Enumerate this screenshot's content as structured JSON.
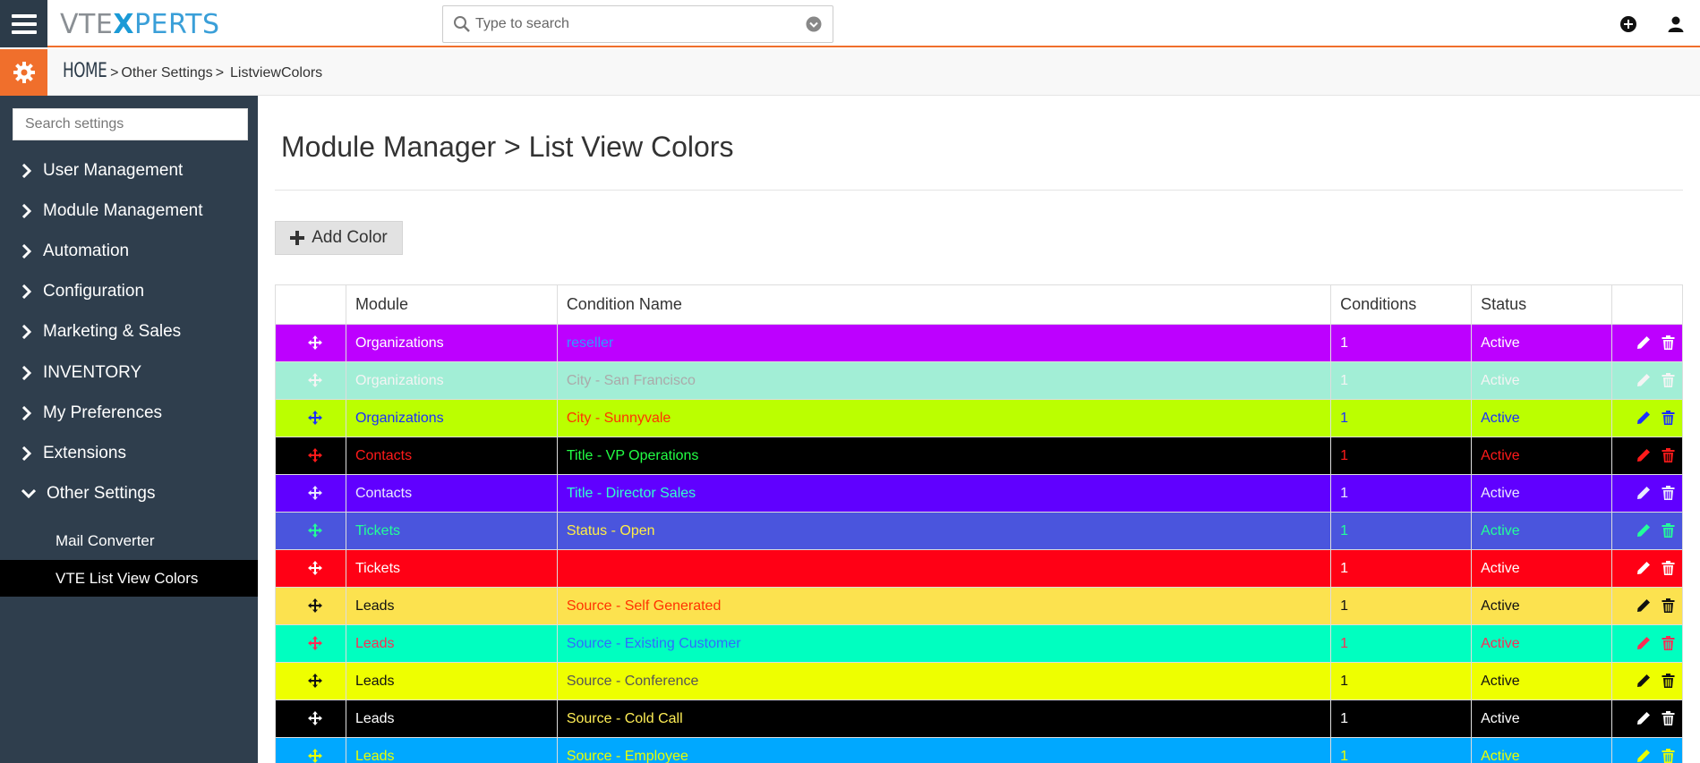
{
  "header": {
    "logo_part1": "VTE",
    "logo_part2": "X",
    "logo_part3": "PERTS",
    "search_placeholder": "Type to search",
    "icons": {
      "menu": "hamburger-icon",
      "search": "search-icon",
      "dropdown": "chevron-circle-down-icon",
      "add": "plus-circle-icon",
      "user": "user-icon"
    }
  },
  "breadcrumb": {
    "home": "HOME",
    "sep": ">",
    "item1": "Other Settings",
    "item2": "ListviewColors",
    "icon": "gear-icon"
  },
  "sidebar": {
    "search_placeholder": "Search settings",
    "items": [
      {
        "label": "User Management",
        "expanded": false
      },
      {
        "label": "Module Management",
        "expanded": false
      },
      {
        "label": "Automation",
        "expanded": false
      },
      {
        "label": "Configuration",
        "expanded": false
      },
      {
        "label": "Marketing & Sales",
        "expanded": false
      },
      {
        "label": "INVENTORY",
        "expanded": false
      },
      {
        "label": "My Preferences",
        "expanded": false
      },
      {
        "label": "Extensions",
        "expanded": false
      },
      {
        "label": "Other Settings",
        "expanded": true
      }
    ],
    "subitems": [
      {
        "label": "Mail Converter",
        "active": false
      },
      {
        "label": "VTE List View Colors",
        "active": true
      }
    ]
  },
  "main": {
    "title": "Module Manager > List View Colors",
    "add_button": "Add Color",
    "columns": [
      "",
      "Module",
      "Condition Name",
      "Conditions",
      "Status",
      ""
    ],
    "rows": [
      {
        "module": "Organizations",
        "condition": "reseller",
        "conditions": "1",
        "status": "Active",
        "bg": "#bd00ff",
        "fg": "#ffffff",
        "cond_fg": "#2f9bff"
      },
      {
        "module": "Organizations",
        "condition": "City - San Francisco",
        "conditions": "1",
        "status": "Active",
        "bg": "#a2eed6",
        "fg": "#f4f4f4",
        "cond_fg": "#aaaaaa"
      },
      {
        "module": "Organizations",
        "condition": "City - Sunnyvale",
        "conditions": "1",
        "status": "Active",
        "bg": "#bbff00",
        "fg": "#1a2fff",
        "cond_fg": "#ff3300"
      },
      {
        "module": "Contacts",
        "condition": "Title - VP Operations",
        "conditions": "1",
        "status": "Active",
        "bg": "#000000",
        "fg": "#ff1a1a",
        "cond_fg": "#22ff44"
      },
      {
        "module": "Contacts",
        "condition": "Title - Director Sales",
        "conditions": "1",
        "status": "Active",
        "bg": "#6000ff",
        "fg": "#eaeaff",
        "cond_fg": "#33ffcc"
      },
      {
        "module": "Tickets",
        "condition": "Status - Open",
        "conditions": "1",
        "status": "Active",
        "bg": "#4a55dd",
        "fg": "#22ff99",
        "cond_fg": "#ffee44"
      },
      {
        "module": "Tickets",
        "condition": "",
        "conditions": "1",
        "status": "Active",
        "bg": "#ff0015",
        "fg": "#ffffff",
        "cond_fg": "#ffffff"
      },
      {
        "module": "Leads",
        "condition": "Source - Self Generated",
        "conditions": "1",
        "status": "Active",
        "bg": "#fce24f",
        "fg": "#111111",
        "cond_fg": "#ff3300"
      },
      {
        "module": "Leads",
        "condition": "Source - Existing Customer",
        "conditions": "1",
        "status": "Active",
        "bg": "#00ffc0",
        "fg": "#ff2a55",
        "cond_fg": "#2f6bff"
      },
      {
        "module": "Leads",
        "condition": "Source - Conference",
        "conditions": "1",
        "status": "Active",
        "bg": "#eeff00",
        "fg": "#111111",
        "cond_fg": "#555555"
      },
      {
        "module": "Leads",
        "condition": "Source - Cold Call",
        "conditions": "1",
        "status": "Active",
        "bg": "#000000",
        "fg": "#ffffff",
        "cond_fg": "#ffee55"
      },
      {
        "module": "Leads",
        "condition": "Source - Employee",
        "conditions": "1",
        "status": "Active",
        "bg": "#00a8ff",
        "fg": "#eaff00",
        "cond_fg": "#eaff00"
      }
    ]
  },
  "colors": {
    "accent": "#f06f2c",
    "sidebar": "#2f3e4d",
    "active_item": "#000000"
  }
}
